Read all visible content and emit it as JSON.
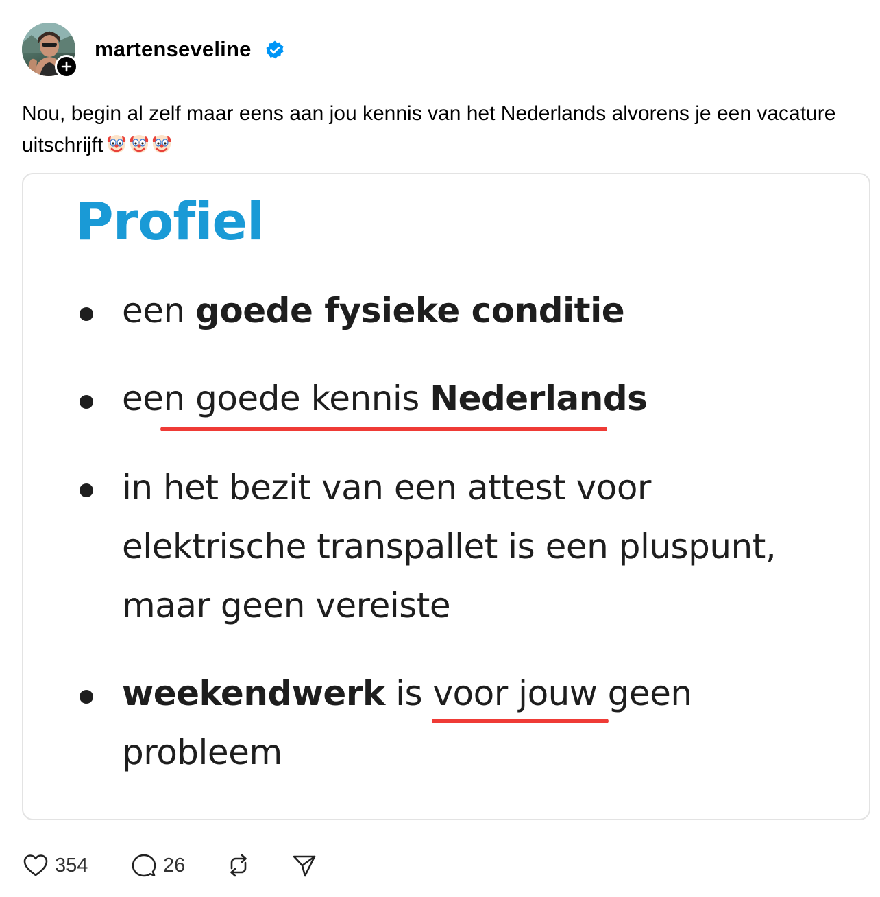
{
  "post": {
    "username": "martenseveline",
    "caption_text": "Nou, begin al zelf maar eens aan jou kennis van het Nederlands alvorens je een vacature uitschrijft",
    "caption_emoji": "🤡🤡🤡"
  },
  "image": {
    "title": "Profiel",
    "items": [
      {
        "normal": "een ",
        "bold": "goede fysieke conditie"
      },
      {
        "normal": "een goede kennis ",
        "bold": "Nederlands"
      },
      {
        "line1": "in het bezit van een attest voor",
        "line2": "elektrische transpallet is een pluspunt,",
        "line3": "maar geen vereiste"
      },
      {
        "bold": "weekendwerk",
        "normal": " is voor jouw geen",
        "line2": "probleem"
      }
    ],
    "underline_color": "#ef3b36",
    "title_color": "#1a9ad6"
  },
  "actions": {
    "likes": "354",
    "comments": "26"
  },
  "icons": [
    "avatar",
    "plus-icon",
    "verified-badge-icon",
    "clown-face-icon",
    "heart-icon",
    "comment-icon",
    "repost-icon",
    "share-icon"
  ],
  "colors": {
    "verified": "#0095f6",
    "text": "#000000"
  }
}
